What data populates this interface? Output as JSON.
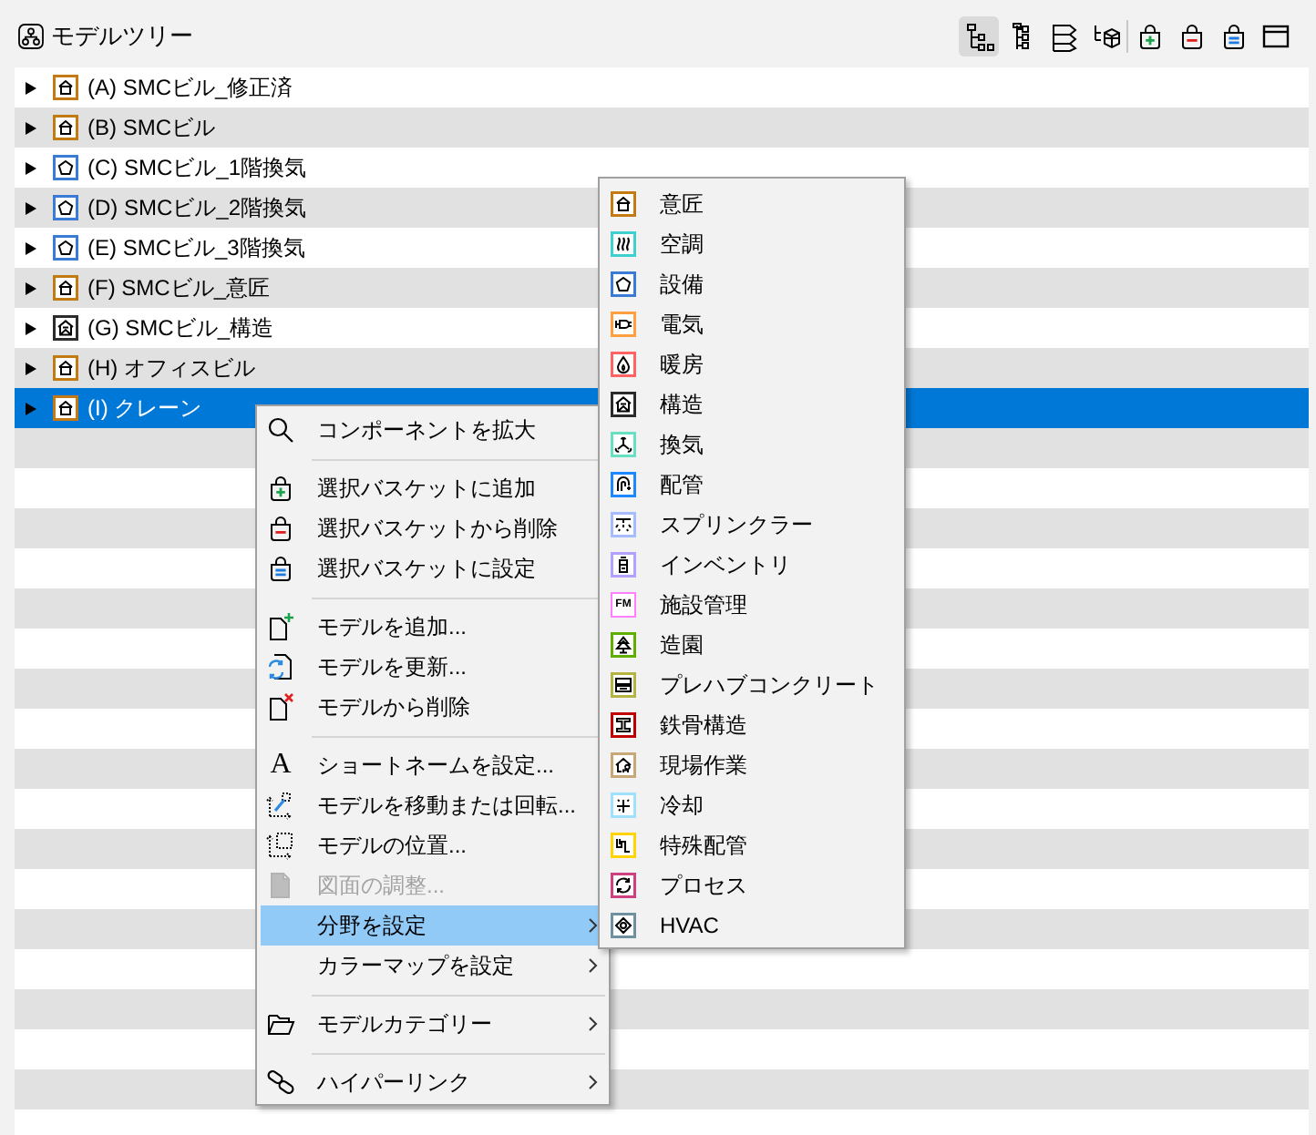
{
  "panel": {
    "title": "モデルツリー"
  },
  "toolbar": {
    "groups": [
      [
        {
          "selected": true
        },
        {
          "selected": false
        },
        {
          "selected": false
        },
        {
          "selected": false
        }
      ],
      [
        {
          "selected": false
        },
        {
          "selected": false
        },
        {
          "selected": false
        },
        {
          "selected": false
        }
      ]
    ]
  },
  "tree": [
    {
      "label": "(A) SMCビル_修正済",
      "kind": "architecture",
      "expanded": false,
      "selected": false
    },
    {
      "label": "(B) SMCビル",
      "kind": "architecture",
      "expanded": false,
      "selected": false
    },
    {
      "label": "(C) SMCビル_1階換気",
      "kind": "equipment",
      "expanded": false,
      "selected": false
    },
    {
      "label": "(D) SMCビル_2階換気",
      "kind": "equipment",
      "expanded": false,
      "selected": false
    },
    {
      "label": "(E) SMCビル_3階換気",
      "kind": "equipment",
      "expanded": false,
      "selected": false
    },
    {
      "label": "(F) SMCビル_意匠",
      "kind": "architecture",
      "expanded": false,
      "selected": false
    },
    {
      "label": "(G) SMCビル_構造",
      "kind": "structure",
      "expanded": false,
      "selected": false
    },
    {
      "label": "(H) オフィスビル",
      "kind": "architecture",
      "expanded": false,
      "selected": false
    },
    {
      "label": "(I) クレーン",
      "kind": "architecture",
      "expanded": false,
      "selected": true
    }
  ],
  "context_menu": {
    "groups": [
      [
        {
          "label": "コンポーネントを拡大",
          "disabled": false,
          "selected": false,
          "submenu": false
        }
      ],
      [
        {
          "label": "選択バスケットに追加",
          "disabled": false,
          "selected": false,
          "submenu": false
        },
        {
          "label": "選択バスケットから削除",
          "disabled": false,
          "selected": false,
          "submenu": false
        },
        {
          "label": "選択バスケットに設定",
          "disabled": false,
          "selected": false,
          "submenu": false
        }
      ],
      [
        {
          "label": "モデルを追加...",
          "disabled": false,
          "selected": false,
          "submenu": false
        },
        {
          "label": "モデルを更新...",
          "disabled": false,
          "selected": false,
          "submenu": false
        },
        {
          "label": "モデルから削除",
          "disabled": false,
          "selected": false,
          "submenu": false
        }
      ],
      [
        {
          "label": "ショートネームを設定...",
          "glyph": "A",
          "disabled": false,
          "selected": false,
          "submenu": false
        },
        {
          "label": "モデルを移動または回転...",
          "disabled": false,
          "selected": false,
          "submenu": false
        },
        {
          "label": "モデルの位置...",
          "disabled": false,
          "selected": false,
          "submenu": false
        },
        {
          "label": "図面の調整...",
          "disabled": true,
          "selected": false,
          "submenu": false
        },
        {
          "label": "分野を設定",
          "disabled": false,
          "selected": true,
          "submenu": true
        },
        {
          "label": "カラーマップを設定",
          "disabled": false,
          "selected": false,
          "submenu": true
        }
      ],
      [
        {
          "label": "モデルカテゴリー",
          "disabled": false,
          "selected": false,
          "submenu": true
        }
      ],
      [
        {
          "label": "ハイパーリンク",
          "disabled": false,
          "selected": false,
          "submenu": true
        }
      ]
    ]
  },
  "submenu": [
    {
      "label": "意匠",
      "color": "#c47a12"
    },
    {
      "label": "空調",
      "color": "#3fd0d0"
    },
    {
      "label": "設備",
      "color": "#3a7bd5"
    },
    {
      "label": "電気",
      "color": "#ff9f40"
    },
    {
      "label": "暖房",
      "color": "#ff6464"
    },
    {
      "label": "構造",
      "color": "#2b2b2b"
    },
    {
      "label": "換気",
      "color": "#66e0c0"
    },
    {
      "label": "配管",
      "color": "#1e88ff"
    },
    {
      "label": "スプリンクラー",
      "color": "#a6bcff"
    },
    {
      "label": "インベントリ",
      "color": "#b4a0ff"
    },
    {
      "label": "施設管理",
      "glyph": "FM",
      "color": "#ff80ff"
    },
    {
      "label": "造園",
      "color": "#5fae00"
    },
    {
      "label": "プレハブコンクリート",
      "color": "#b4b440"
    },
    {
      "label": "鉄骨構造",
      "color": "#c00000"
    },
    {
      "label": "現場作業",
      "color": "#c8a878"
    },
    {
      "label": "冷却",
      "color": "#a0e0ff"
    },
    {
      "label": "特殊配管",
      "color": "#ffd400"
    },
    {
      "label": "プロセス",
      "color": "#d04080"
    },
    {
      "label": "HVAC",
      "color": "#7090a0"
    }
  ]
}
